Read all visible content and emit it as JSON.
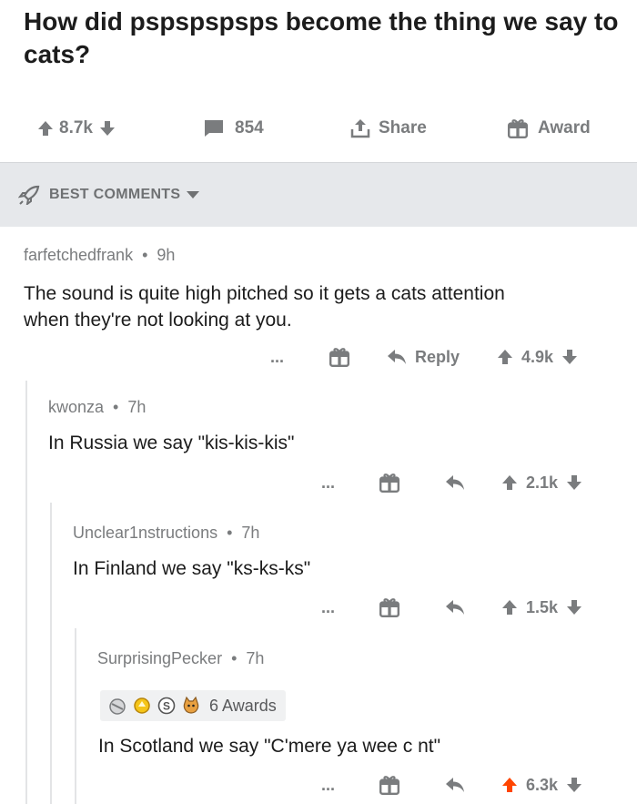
{
  "post": {
    "title": "How did pspspspsps become the thing we say to cats?",
    "upvotes": "8.7k",
    "comments": "854",
    "share_label": "Share",
    "award_label": "Award"
  },
  "sort": {
    "label": "BEST COMMENTS"
  },
  "comments": [
    {
      "author": "farfetchedfrank",
      "age": "9h",
      "text": "The sound is quite high pitched so it gets a cats attention when they're not looking at you.",
      "reply_label": "Reply",
      "more": "...",
      "score": "4.9k"
    },
    {
      "author": "kwonza",
      "age": "7h",
      "text": "In Russia we say \"kis-kis-kis\"",
      "more": "...",
      "score": "2.1k"
    },
    {
      "author": "Unclear1nstructions",
      "age": "7h",
      "text": "In Finland we say \"ks-ks-ks\"",
      "more": "...",
      "score": "1.5k"
    },
    {
      "author": "SurprisingPecker",
      "age": "7h",
      "awards_label": "6 Awards",
      "text": "In Scotland we say \"C'mere ya wee c  nt\"",
      "more": "...",
      "score": "6.3k",
      "upvoted": true
    }
  ],
  "icons": {
    "upvote": "arrow-up-icon",
    "downvote": "arrow-down-icon",
    "comment": "comment-icon",
    "share": "share-icon",
    "award": "gift-icon",
    "reply": "reply-icon",
    "sort": "rocket-icon"
  },
  "colors": {
    "upvoted": "#ff4500",
    "muted": "#7a7c7e"
  }
}
